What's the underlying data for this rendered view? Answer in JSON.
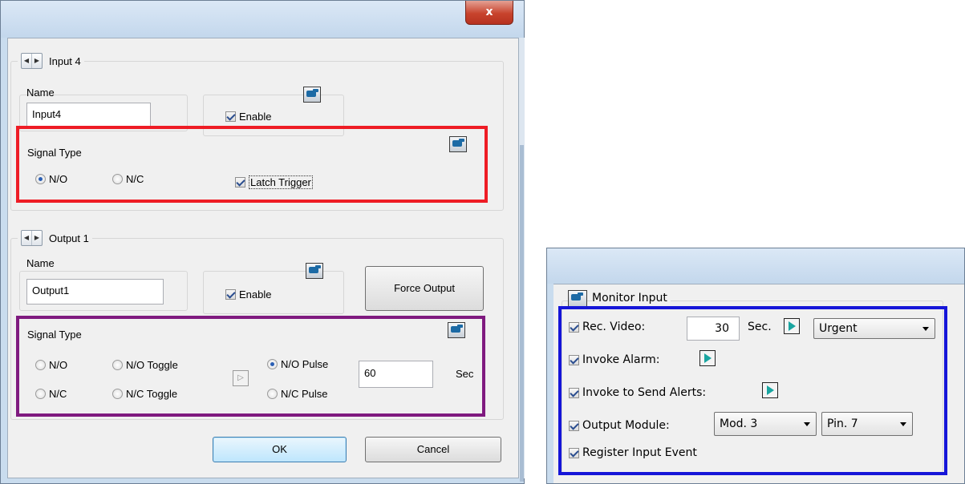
{
  "dialog": {
    "close_label": "x",
    "input_group": {
      "title": "Input 4",
      "name_label": "Name",
      "name_value": "Input4",
      "enable_label": "Enable",
      "enable_checked": true,
      "signal_type_label": "Signal Type",
      "no_label": "N/O",
      "nc_label": "N/C",
      "selected": "N/O",
      "latch_label": "Latch Trigger",
      "latch_checked": true
    },
    "output_group": {
      "title": "Output 1",
      "name_label": "Name",
      "name_value": "Output1",
      "enable_label": "Enable",
      "enable_checked": true,
      "force_output_label": "Force Output",
      "signal_type_label": "Signal Type",
      "no_label": "N/O",
      "nc_label": "N/C",
      "no_toggle_label": "N/O Toggle",
      "nc_toggle_label": "N/C Toggle",
      "no_pulse_label": "N/O Pulse",
      "nc_pulse_label": "N/C Pulse",
      "selected": "N/O Pulse",
      "pulse_value": "60",
      "sec_label": "Sec"
    },
    "ok_label": "OK",
    "cancel_label": "Cancel"
  },
  "monitor_panel": {
    "title": "Monitor Input",
    "rec_video_label": "Rec. Video:",
    "rec_video_value": "30",
    "sec_label": "Sec.",
    "priority_selected": "Urgent",
    "invoke_alarm_label": "Invoke Alarm:",
    "invoke_alerts_label": "Invoke to Send Alerts:",
    "output_module_label": "Output Module:",
    "module_selected": "Mod. 3",
    "pin_selected": "Pin. 7",
    "register_label": "Register Input Event"
  },
  "colors": {
    "highlight_red": "#ee1c25",
    "highlight_purple": "#7f1a7f",
    "highlight_blue": "#1515d8",
    "titlebar": "#c9dcee"
  },
  "icons": [
    "close-icon",
    "hand-pointer-icon",
    "play-arrow-icon",
    "left-right-arrows-icon"
  ]
}
